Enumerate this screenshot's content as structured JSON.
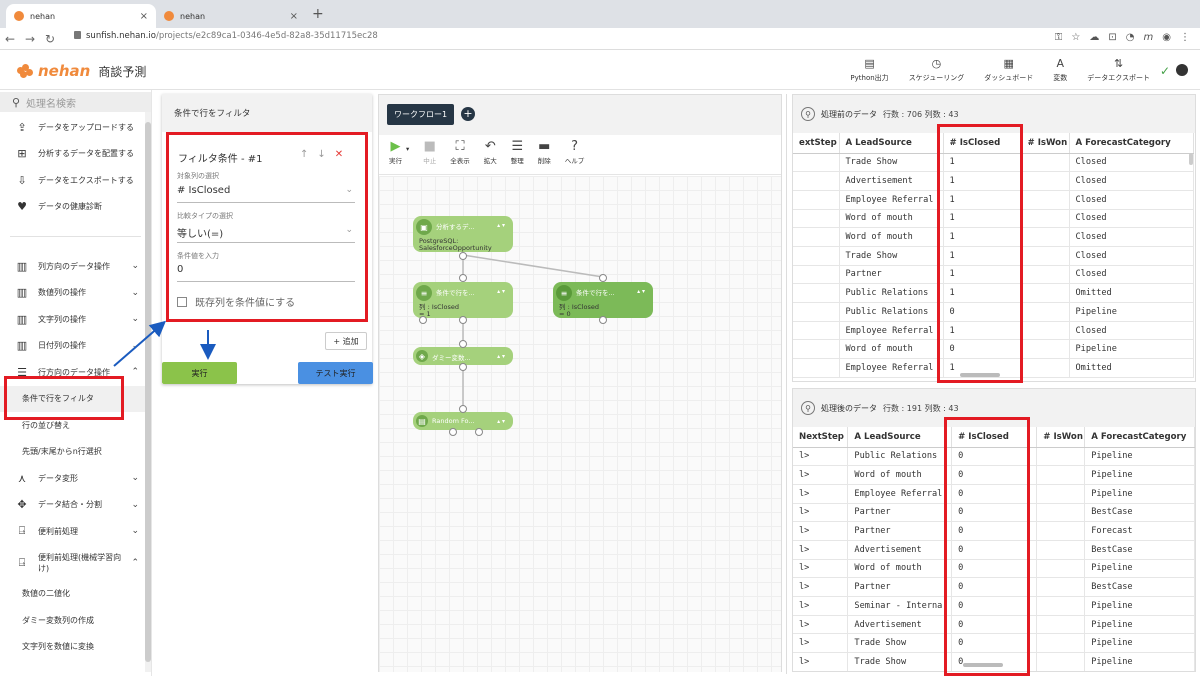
{
  "browser": {
    "tabs": [
      {
        "title": "nehan",
        "close": "×"
      },
      {
        "title": "nehan",
        "close": "×"
      }
    ],
    "new_tab": "+",
    "url_host": "sunfish.nehan.io",
    "url_path": "/projects/e2c89ca1-0346-4e5d-82a8-35d11715ec28"
  },
  "header": {
    "logo": "nehan",
    "project": "商談予測",
    "tools": [
      {
        "icon": "document-icon",
        "label": "Python出力",
        "glyph": "▤"
      },
      {
        "icon": "clock-icon",
        "label": "スケジューリング",
        "glyph": "◷"
      },
      {
        "icon": "dashboard-icon",
        "label": "ダッシュボード",
        "glyph": "▦"
      },
      {
        "icon": "variable-icon",
        "label": "変数",
        "glyph": "A"
      },
      {
        "icon": "export-icon",
        "label": "データエクスポート",
        "glyph": "⇅"
      }
    ]
  },
  "sidebar": {
    "search_placeholder": "処理名検索",
    "top_items": [
      {
        "label": "データをアップロードする",
        "icon": "upload-icon",
        "glyph": "⇪"
      },
      {
        "label": "分析するデータを配置する",
        "icon": "place-data-icon",
        "glyph": "⊞"
      },
      {
        "label": "データをエクスポートする",
        "icon": "download-icon",
        "glyph": "⇩"
      },
      {
        "label": "データの健康診断",
        "icon": "heart-icon",
        "glyph": "♥"
      }
    ],
    "groups": [
      {
        "label": "列方向のデータ操作",
        "icon": "columns-icon",
        "glyph": "▥",
        "chevron": "⌄"
      },
      {
        "label": "数値列の操作",
        "icon": "columns-icon",
        "glyph": "▥",
        "chevron": "⌄"
      },
      {
        "label": "文字列の操作",
        "icon": "columns-icon",
        "glyph": "▥",
        "chevron": "⌄"
      },
      {
        "label": "日付列の操作",
        "icon": "columns-icon",
        "glyph": "▥",
        "chevron": "⌄"
      },
      {
        "label": "行方向のデータ操作",
        "icon": "rows-icon",
        "glyph": "☰",
        "chevron": "⌃"
      }
    ],
    "row_subitems": [
      "条件で行をフィルタ",
      "行の並び替え",
      "先頭/末尾からn行選択"
    ],
    "groups2": [
      {
        "label": "データ変形",
        "icon": "transform-icon",
        "glyph": "⋏",
        "chevron": "⌄"
      },
      {
        "label": "データ結合・分割",
        "icon": "merge-icon",
        "glyph": "✥",
        "chevron": "⌄"
      },
      {
        "label": "便利前処理",
        "icon": "preprocess-icon",
        "glyph": "⍈",
        "chevron": "⌄"
      },
      {
        "label": "便利前処理(機械学習向け)",
        "icon": "preprocess-icon",
        "glyph": "⍈",
        "chevron": "⌃"
      }
    ],
    "ml_subitems": [
      "数値の二値化",
      "ダミー変数列の作成",
      "文字列を数値に変換"
    ]
  },
  "filter_panel": {
    "title": "条件で行をフィルタ",
    "card_title": "フィルタ条件 - #1",
    "up": "↑",
    "down": "↓",
    "delete": "✕",
    "target_label": "対象列の選択",
    "target_value": "# IsClosed",
    "compare_label": "比較タイプの選択",
    "compare_value": "等しい(=)",
    "condition_label": "条件値を入力",
    "condition_value": "0",
    "checkbox_label": "既存列を条件値にする",
    "add_label": "+ 追加",
    "run_label": "実行",
    "test_label": "テスト実行"
  },
  "workflow": {
    "tab": "ワークフロー1",
    "tools": [
      {
        "label": "実行",
        "icon": "play-icon",
        "glyph": "▶"
      },
      {
        "label": "中止",
        "icon": "stop-icon",
        "glyph": "■"
      },
      {
        "label": "全表示",
        "icon": "fit-icon",
        "glyph": "⛶"
      },
      {
        "label": "拡大",
        "icon": "undo-icon",
        "glyph": "↶"
      },
      {
        "label": "整理",
        "icon": "list-icon",
        "glyph": "☰"
      },
      {
        "label": "削除",
        "icon": "trash-icon",
        "glyph": "🗑"
      },
      {
        "label": "ヘルプ",
        "icon": "help-icon",
        "glyph": "?"
      }
    ],
    "nodes": [
      {
        "title": "分析するデ...",
        "sub": "PostgreSQL:",
        "sub2": "SalesforceOpportunity"
      },
      {
        "title": "条件で行を...",
        "sub": "列 : IsClosed",
        "sub2": "= 1"
      },
      {
        "title": "条件で行を...",
        "sub": "列 : IsClosed",
        "sub2": "= 0"
      },
      {
        "title": "ダミー変数...",
        "sub": "",
        "sub2": ""
      },
      {
        "title": "Random Fo...",
        "sub": "",
        "sub2": ""
      }
    ]
  },
  "before_panel": {
    "title": "処理前のデータ",
    "meta": "行数 : 706 列数 : 43",
    "headers": [
      "extStep",
      "A LeadSource",
      "# IsClosed",
      "# IsWon",
      "A ForecastCategory"
    ],
    "rows": [
      [
        "",
        "Trade Show",
        "1",
        "",
        "Closed"
      ],
      [
        "",
        "Advertisement",
        "1",
        "",
        "Closed"
      ],
      [
        "",
        "Employee Referral",
        "1",
        "",
        "Closed"
      ],
      [
        "",
        "Word of mouth",
        "1",
        "",
        "Closed"
      ],
      [
        "",
        "Word of mouth",
        "1",
        "",
        "Closed"
      ],
      [
        "",
        "Trade Show",
        "1",
        "",
        "Closed"
      ],
      [
        "",
        "Partner",
        "1",
        "",
        "Closed"
      ],
      [
        "",
        "Public Relations",
        "1",
        "",
        "Omitted"
      ],
      [
        "",
        "Public Relations",
        "0",
        "",
        "Pipeline"
      ],
      [
        "",
        "Employee Referral",
        "1",
        "",
        "Closed"
      ],
      [
        "",
        "Word of mouth",
        "0",
        "",
        "Pipeline"
      ],
      [
        "",
        "Employee Referral",
        "1",
        "",
        "Omitted"
      ]
    ]
  },
  "after_panel": {
    "title": "処理後のデータ",
    "meta": "行数 : 191 列数 : 43",
    "headers": [
      "NextStep",
      "A LeadSource",
      "# IsClosed",
      "# IsWon",
      "A ForecastCategory"
    ],
    "rows": [
      [
        "l>",
        "Public Relations",
        "0",
        "",
        "Pipeline"
      ],
      [
        "l>",
        "Word of mouth",
        "0",
        "",
        "Pipeline"
      ],
      [
        "l>",
        "Employee Referral",
        "0",
        "",
        "Pipeline"
      ],
      [
        "l>",
        "Partner",
        "0",
        "",
        "BestCase"
      ],
      [
        "l>",
        "Partner",
        "0",
        "",
        "Forecast"
      ],
      [
        "l>",
        "Advertisement",
        "0",
        "",
        "BestCase"
      ],
      [
        "l>",
        "Word of mouth",
        "0",
        "",
        "Pipeline"
      ],
      [
        "l>",
        "Partner",
        "0",
        "",
        "BestCase"
      ],
      [
        "l>",
        "Seminar - Interna",
        "0",
        "",
        "Pipeline"
      ],
      [
        "l>",
        "Advertisement",
        "0",
        "",
        "Pipeline"
      ],
      [
        "l>",
        "Trade Show",
        "0",
        "",
        "Pipeline"
      ],
      [
        "l>",
        "Trade Show",
        "0",
        "",
        "Pipeline"
      ]
    ]
  },
  "colors": {
    "accent": "#f08a3c",
    "highlight": "#e31b23",
    "arrow": "#1a5bbf",
    "node_green": "#8bc34a",
    "run_green": "#8bc34a",
    "test_blue": "#4a90e2",
    "tab_dark": "#263645"
  }
}
